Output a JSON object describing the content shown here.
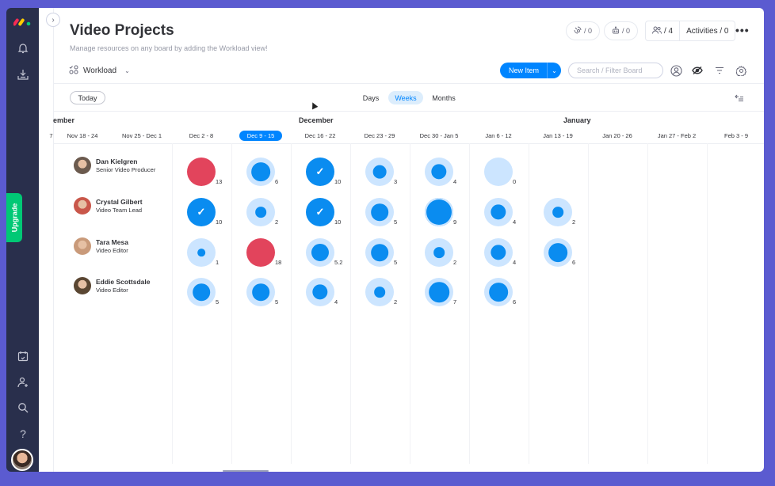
{
  "sidebar": {
    "upgrade_label": "Upgrade",
    "icons": [
      "bell-icon",
      "download-icon",
      "calendar-icon",
      "add-user-icon",
      "search-icon",
      "help-icon"
    ]
  },
  "header": {
    "title": "Video Projects",
    "subtitle": "Manage resources on any board by adding the Workload view!",
    "view_label": "Workload",
    "integrations_count": "/ 0",
    "automations_count": "/ 0",
    "members_count": "/ 4",
    "activities_label": "Activities / 0"
  },
  "toolbar": {
    "new_item_label": "New Item",
    "search_placeholder": "Search / Filter Board",
    "today_label": "Today",
    "scales": [
      "Days",
      "Weeks",
      "Months"
    ],
    "active_scale": "Weeks"
  },
  "timeline": {
    "months": [
      {
        "label": "ember"
      },
      {
        "label": "December"
      },
      {
        "label": "January"
      }
    ],
    "weeks": [
      "7",
      "Nov 18 - 24",
      "Nov 25 - Dec 1",
      "Dec 2 - 8",
      "Dec 9 - 15",
      "Dec 16 - 22",
      "Dec 23 - 29",
      "Dec 30 - Jan 5",
      "Jan 6 - 12",
      "Jan 13 - 19",
      "Jan 20 - 26",
      "Jan 27 - Feb 2",
      "Feb 3 - 9"
    ],
    "current_week": "Dec 9 - 15"
  },
  "colors": {
    "primary": "#0085ff",
    "bubble_light": "#cce5ff",
    "bubble_core": "#0a8cf0",
    "overload": "#e2445c",
    "upgrade": "#00c875",
    "sidebar_bg": "#292f4c",
    "frame_bg": "#5b5bd0"
  },
  "workload": {
    "capacity": 10,
    "people": [
      {
        "name": "Dan Kielgren",
        "role": "Senior Video Producer",
        "avatar_color": "#6b5a4e",
        "values": [
          "13",
          "6",
          "10",
          "3",
          "4",
          "0",
          null
        ]
      },
      {
        "name": "Crystal Gilbert",
        "role": "Video Team Lead",
        "avatar_color": "#c9574a",
        "values": [
          "10",
          "2",
          "10",
          "5",
          "9",
          "4",
          "2"
        ]
      },
      {
        "name": "Tara Mesa",
        "role": "Video Editor",
        "avatar_color": "#c99a7a",
        "values": [
          "1",
          "18",
          "5.2",
          "5",
          "2",
          "4",
          "6"
        ]
      },
      {
        "name": "Eddie Scottsdale",
        "role": "Video Editor",
        "avatar_color": "#5a4632",
        "values": [
          "5",
          "5",
          "4",
          "2",
          "7",
          "6",
          null
        ]
      }
    ]
  }
}
